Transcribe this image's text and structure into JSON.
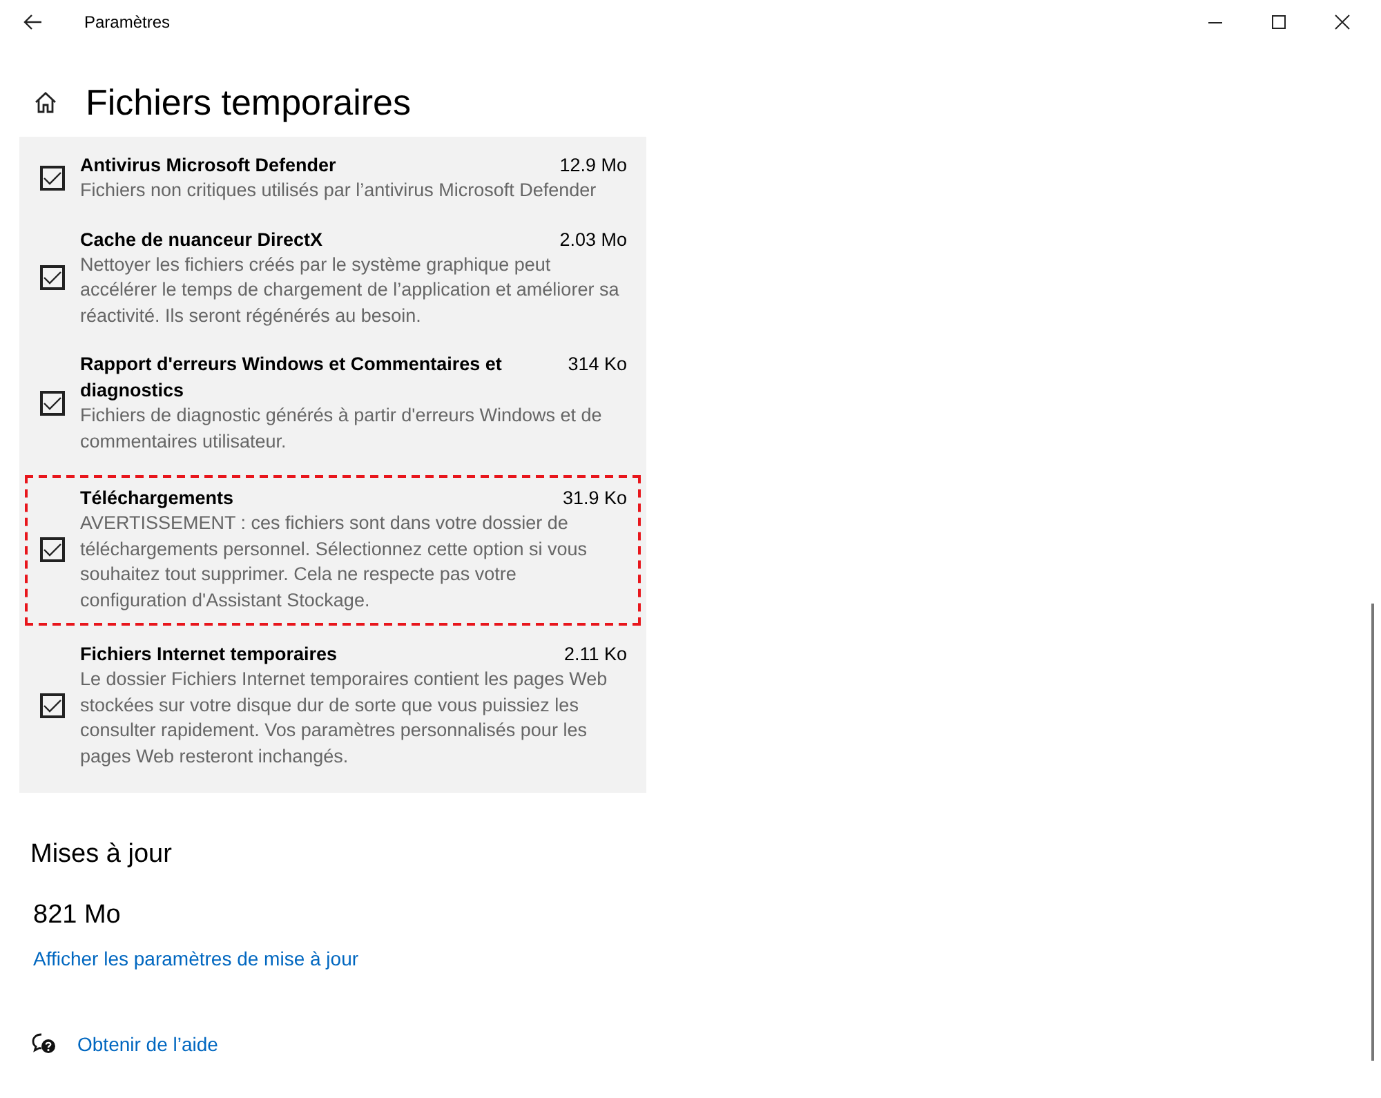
{
  "window": {
    "title": "Paramètres"
  },
  "page_title": "Fichiers temporaires",
  "items": [
    {
      "title": "Antivirus Microsoft Defender",
      "size": "12.9 Mo",
      "description": "Fichiers non critiques utilisés par l’antivirus Microsoft Defender",
      "checked": true,
      "highlighted": false
    },
    {
      "title": "Cache de nuanceur DirectX",
      "size": "2.03 Mo",
      "description": "Nettoyer les fichiers créés par le système graphique peut accélérer le temps de chargement de l’application et améliorer sa réactivité. Ils seront régénérés au besoin.",
      "checked": true,
      "highlighted": false
    },
    {
      "title": "Rapport d'erreurs Windows et Commentaires et diagnostics",
      "size": "314 Ko",
      "description": "Fichiers de diagnostic générés à partir d'erreurs Windows et de commentaires utilisateur.",
      "checked": true,
      "highlighted": false
    },
    {
      "title": "Téléchargements",
      "size": "31.9 Ko",
      "description": "AVERTISSEMENT : ces fichiers sont dans votre dossier de téléchargements personnel. Sélectionnez cette option si vous souhaitez tout supprimer. Cela ne respecte pas votre configuration d'Assistant Stockage.",
      "checked": true,
      "highlighted": true
    },
    {
      "title": "Fichiers Internet temporaires",
      "size": "2.11 Ko",
      "description": "Le dossier Fichiers Internet temporaires contient les pages Web stockées sur votre disque dur de sorte que vous puissiez les consulter rapidement. Vos paramètres personnalisés pour les pages Web resteront inchangés.",
      "checked": true,
      "highlighted": false
    }
  ],
  "updates": {
    "heading": "Mises à jour",
    "size": "821 Mo",
    "link": "Afficher les paramètres de mise à jour"
  },
  "help_link": "Obtenir de l’aide"
}
